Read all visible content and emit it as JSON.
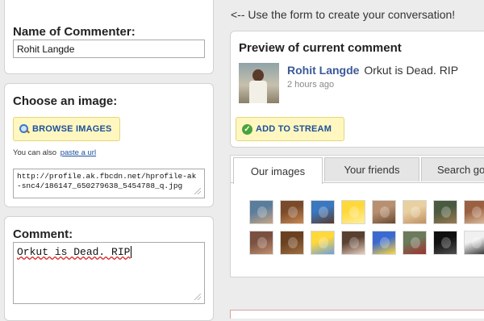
{
  "instruction": "<-- Use the form to create your conversation!",
  "commenter": {
    "label": "Name of Commenter:",
    "value": "Rohit Langde"
  },
  "image_chooser": {
    "label": "Choose an image:",
    "browse_button": "BROWSE IMAGES",
    "paste_prefix": "You can also",
    "paste_link": "paste a url",
    "url_value": "http://profile.ak.fbcdn.net/hprofile-ak-snc4/186147_650279638_5454788_q.jpg"
  },
  "comment": {
    "label": "Comment:",
    "value": "Orkut is Dead. RIP"
  },
  "preview": {
    "title": "Preview of current comment",
    "author": "Rohit Langde",
    "text": "Orkut is Dead. RIP",
    "time": "2 hours ago",
    "add_button": "ADD TO STREAM"
  },
  "tabs": [
    {
      "label": "Our images"
    },
    {
      "label": "Your friends"
    },
    {
      "label": "Search go"
    }
  ],
  "thumbnails": [
    {
      "name": "thumb-golfer",
      "colors": [
        "#5b7d9c",
        "#c7a583"
      ]
    },
    {
      "name": "thumb-dog-scene",
      "colors": [
        "#7a4a2a",
        "#c98a52"
      ]
    },
    {
      "name": "thumb-politician",
      "colors": [
        "#3a78c0",
        "#5a3a2a"
      ]
    },
    {
      "name": "thumb-homer",
      "colors": [
        "#ffd83a",
        "#fff0a0"
      ]
    },
    {
      "name": "thumb-actor",
      "colors": [
        "#b89070",
        "#6a4a30"
      ]
    },
    {
      "name": "thumb-blonde",
      "colors": [
        "#e8d0a0",
        "#c09060"
      ]
    },
    {
      "name": "thumb-han-solo",
      "colors": [
        "#4a5a40",
        "#9a7a50"
      ]
    },
    {
      "name": "thumb-host",
      "colors": [
        "#9a6040",
        "#e0c0a0"
      ]
    },
    {
      "name": "thumb-woman",
      "colors": [
        "#7a5040",
        "#c09070"
      ]
    },
    {
      "name": "thumb-chewbacca",
      "colors": [
        "#6a4020",
        "#a07040"
      ]
    },
    {
      "name": "thumb-bart",
      "colors": [
        "#ffd83a",
        "#6aa0e0"
      ]
    },
    {
      "name": "thumb-leia",
      "colors": [
        "#5a4030",
        "#e8d0c0"
      ]
    },
    {
      "name": "thumb-marge",
      "colors": [
        "#3a6ad0",
        "#ffd83a"
      ]
    },
    {
      "name": "thumb-boba-fett",
      "colors": [
        "#6a7a5a",
        "#a03030"
      ]
    },
    {
      "name": "thumb-darth-vader",
      "colors": [
        "#101010",
        "#505050"
      ]
    },
    {
      "name": "thumb-stormtrooper",
      "colors": [
        "#f0f0f0",
        "#303030"
      ]
    }
  ]
}
